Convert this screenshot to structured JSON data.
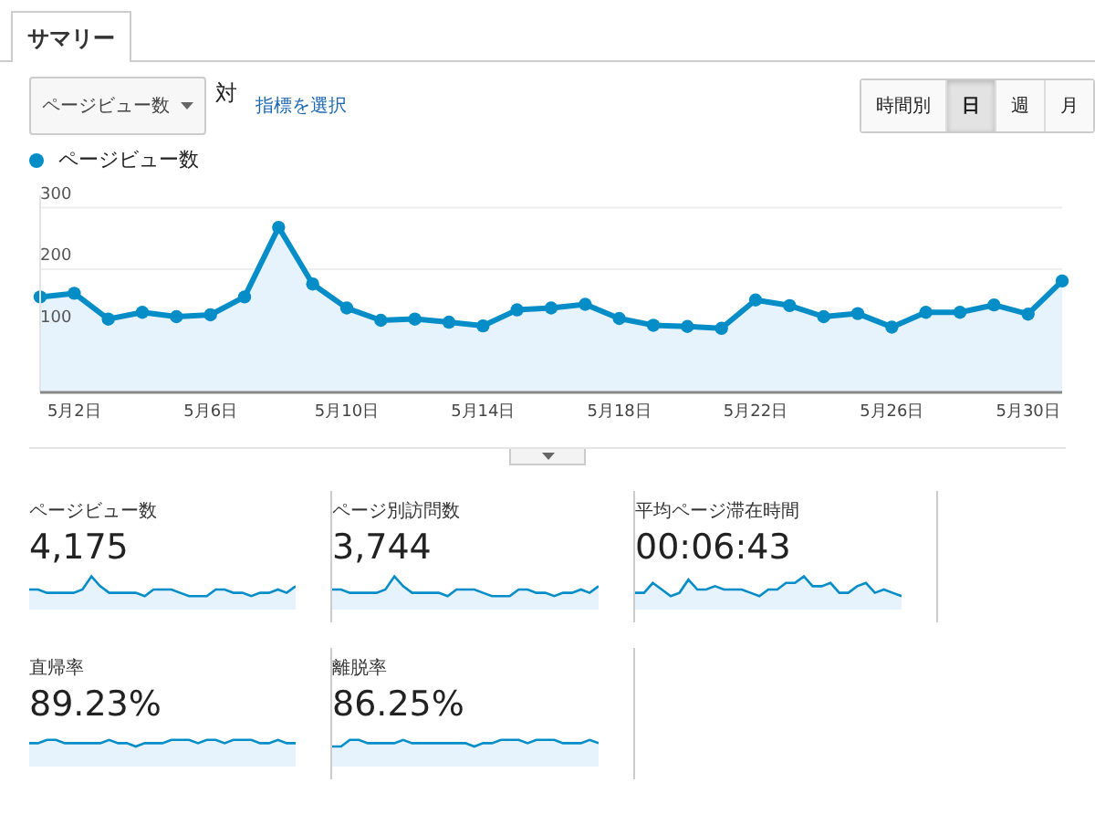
{
  "tabs": [
    {
      "label": "サマリー",
      "selected": true
    }
  ],
  "controls": {
    "metric_dropdown": "ページビュー数",
    "versus": "対",
    "select_metric_link": "指標を選択",
    "periods": [
      {
        "label": "時間別",
        "selected": false
      },
      {
        "label": "日",
        "selected": true
      },
      {
        "label": "週",
        "selected": false
      },
      {
        "label": "月",
        "selected": false
      }
    ]
  },
  "chart": {
    "chart_data": {
      "type": "area",
      "categories": [
        null,
        "5月2日",
        null,
        null,
        null,
        "5月6日",
        null,
        null,
        null,
        "5月10日",
        null,
        null,
        null,
        "5月14日",
        null,
        null,
        null,
        "5月18日",
        null,
        null,
        null,
        "5月22日",
        null,
        null,
        null,
        "5月26日",
        null,
        null,
        null,
        "5月30日",
        null
      ],
      "series": [
        {
          "name": "ページビュー数",
          "color": "#058dc7",
          "values": [
            155,
            161,
            119,
            130,
            123,
            126,
            155,
            268,
            176,
            137,
            117,
            119,
            114,
            108,
            134,
            137,
            143,
            120,
            109,
            107,
            104,
            150,
            141,
            123,
            128,
            106,
            130,
            130,
            142,
            127,
            181
          ]
        }
      ],
      "ylim": [
        0,
        320
      ],
      "yticks": [
        100,
        200,
        300
      ]
    }
  },
  "metrics": [
    {
      "label": "ページビュー数",
      "value": "4,175"
    },
    {
      "label": "ページ別訪問数",
      "value": "3,744"
    },
    {
      "label": "平均ページ滞在時間",
      "value": "00:06:43"
    },
    {
      "label": "直帰率",
      "value": "89.23%"
    },
    {
      "label": "離脱率",
      "value": "86.25%"
    }
  ]
}
